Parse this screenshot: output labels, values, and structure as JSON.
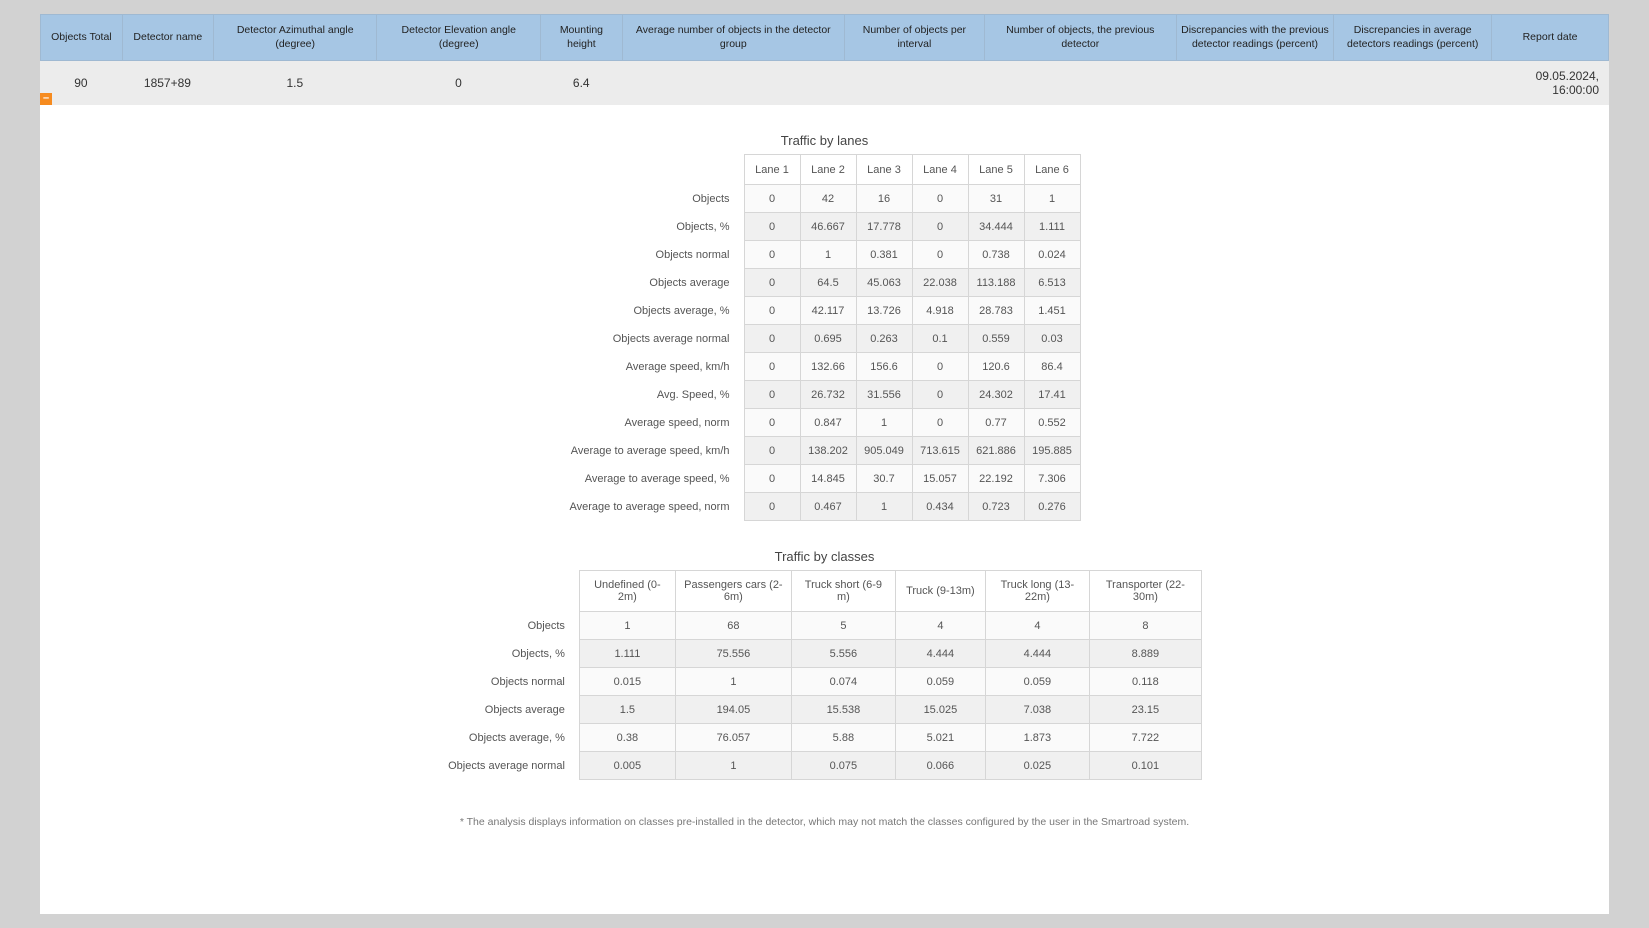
{
  "top": {
    "headers": [
      "Objects Total",
      "Detector name",
      "Detector Azimuthal angle (degree)",
      "Detector Elevation angle (degree)",
      "Mounting height",
      "Average number of objects in the detector group",
      "Number of objects per interval",
      "Number of objects, the previous detector",
      "Discrepancies with the previous detector readings (percent)",
      "Discrepancies in average detectors readings (percent)",
      "Report date"
    ],
    "row": {
      "objects_total": "90",
      "detector_name": "1857+89",
      "azimuth": "1.5",
      "elevation": "0",
      "mount_height": "6.4",
      "avg_group": "",
      "per_interval": "",
      "prev_detector": "",
      "discrep_prev": "",
      "discrep_avg": "",
      "report_date": "09.05.2024, 16:00:00"
    },
    "collapse_glyph": "–"
  },
  "lanes": {
    "title": "Traffic by lanes",
    "columns": [
      "Lane 1",
      "Lane 2",
      "Lane 3",
      "Lane 4",
      "Lane 5",
      "Lane 6"
    ],
    "rows": [
      {
        "label": "Objects",
        "v": [
          "0",
          "42",
          "16",
          "0",
          "31",
          "1"
        ]
      },
      {
        "label": "Objects, %",
        "v": [
          "0",
          "46.667",
          "17.778",
          "0",
          "34.444",
          "1.111"
        ]
      },
      {
        "label": "Objects normal",
        "v": [
          "0",
          "1",
          "0.381",
          "0",
          "0.738",
          "0.024"
        ]
      },
      {
        "label": "Objects average",
        "v": [
          "0",
          "64.5",
          "45.063",
          "22.038",
          "113.188",
          "6.513"
        ]
      },
      {
        "label": "Objects average, %",
        "v": [
          "0",
          "42.117",
          "13.726",
          "4.918",
          "28.783",
          "1.451"
        ]
      },
      {
        "label": "Objects average normal",
        "v": [
          "0",
          "0.695",
          "0.263",
          "0.1",
          "0.559",
          "0.03"
        ]
      },
      {
        "label": "Average speed, km/h",
        "v": [
          "0",
          "132.66",
          "156.6",
          "0",
          "120.6",
          "86.4"
        ]
      },
      {
        "label": "Avg. Speed, %",
        "v": [
          "0",
          "26.732",
          "31.556",
          "0",
          "24.302",
          "17.41"
        ]
      },
      {
        "label": "Average speed, norm",
        "v": [
          "0",
          "0.847",
          "1",
          "0",
          "0.77",
          "0.552"
        ]
      },
      {
        "label": "Average to average speed, km/h",
        "v": [
          "0",
          "138.202",
          "905.049",
          "713.615",
          "621.886",
          "195.885"
        ]
      },
      {
        "label": "Average to average speed, %",
        "v": [
          "0",
          "14.845",
          "30.7",
          "15.057",
          "22.192",
          "7.306"
        ]
      },
      {
        "label": "Average to average speed, norm",
        "v": [
          "0",
          "0.467",
          "1",
          "0.434",
          "0.723",
          "0.276"
        ]
      }
    ]
  },
  "classes": {
    "title": "Traffic by classes",
    "columns": [
      "Undefined (0-2m)",
      "Passengers cars (2-6m)",
      "Truck short (6-9 m)",
      "Truck (9-13m)",
      "Truck long (13-22m)",
      "Transporter (22-30m)"
    ],
    "rows": [
      {
        "label": "Objects",
        "v": [
          "1",
          "68",
          "5",
          "4",
          "4",
          "8"
        ]
      },
      {
        "label": "Objects, %",
        "v": [
          "1.111",
          "75.556",
          "5.556",
          "4.444",
          "4.444",
          "8.889"
        ]
      },
      {
        "label": "Objects normal",
        "v": [
          "0.015",
          "1",
          "0.074",
          "0.059",
          "0.059",
          "0.118"
        ]
      },
      {
        "label": "Objects average",
        "v": [
          "1.5",
          "194.05",
          "15.538",
          "15.025",
          "7.038",
          "23.15"
        ]
      },
      {
        "label": "Objects average, %",
        "v": [
          "0.38",
          "76.057",
          "5.88",
          "5.021",
          "1.873",
          "7.722"
        ]
      },
      {
        "label": "Objects average normal",
        "v": [
          "0.005",
          "1",
          "0.075",
          "0.066",
          "0.025",
          "0.101"
        ]
      }
    ]
  },
  "footnote": "* The analysis displays information on classes pre-installed in the detector, which may not match the classes configured by the user in the Smartroad system.",
  "chart_data": [
    {
      "type": "table",
      "title": "Traffic by lanes",
      "categories": [
        "Lane 1",
        "Lane 2",
        "Lane 3",
        "Lane 4",
        "Lane 5",
        "Lane 6"
      ],
      "series": [
        {
          "name": "Objects",
          "values": [
            0,
            42,
            16,
            0,
            31,
            1
          ]
        },
        {
          "name": "Objects, %",
          "values": [
            0,
            46.667,
            17.778,
            0,
            34.444,
            1.111
          ]
        },
        {
          "name": "Objects normal",
          "values": [
            0,
            1,
            0.381,
            0,
            0.738,
            0.024
          ]
        },
        {
          "name": "Objects average",
          "values": [
            0,
            64.5,
            45.063,
            22.038,
            113.188,
            6.513
          ]
        },
        {
          "name": "Objects average, %",
          "values": [
            0,
            42.117,
            13.726,
            4.918,
            28.783,
            1.451
          ]
        },
        {
          "name": "Objects average normal",
          "values": [
            0,
            0.695,
            0.263,
            0.1,
            0.559,
            0.03
          ]
        },
        {
          "name": "Average speed, km/h",
          "values": [
            0,
            132.66,
            156.6,
            0,
            120.6,
            86.4
          ]
        },
        {
          "name": "Avg. Speed, %",
          "values": [
            0,
            26.732,
            31.556,
            0,
            24.302,
            17.41
          ]
        },
        {
          "name": "Average speed, norm",
          "values": [
            0,
            0.847,
            1,
            0,
            0.77,
            0.552
          ]
        },
        {
          "name": "Average to average speed, km/h",
          "values": [
            0,
            138.202,
            905.049,
            713.615,
            621.886,
            195.885
          ]
        },
        {
          "name": "Average to average speed, %",
          "values": [
            0,
            14.845,
            30.7,
            15.057,
            22.192,
            7.306
          ]
        },
        {
          "name": "Average to average speed, norm",
          "values": [
            0,
            0.467,
            1,
            0.434,
            0.723,
            0.276
          ]
        }
      ]
    },
    {
      "type": "table",
      "title": "Traffic by classes",
      "categories": [
        "Undefined (0-2m)",
        "Passengers cars (2-6m)",
        "Truck short (6-9 m)",
        "Truck (9-13m)",
        "Truck long (13-22m)",
        "Transporter (22-30m)"
      ],
      "series": [
        {
          "name": "Objects",
          "values": [
            1,
            68,
            5,
            4,
            4,
            8
          ]
        },
        {
          "name": "Objects, %",
          "values": [
            1.111,
            75.556,
            5.556,
            4.444,
            4.444,
            8.889
          ]
        },
        {
          "name": "Objects normal",
          "values": [
            0.015,
            1,
            0.074,
            0.059,
            0.059,
            0.118
          ]
        },
        {
          "name": "Objects average",
          "values": [
            1.5,
            194.05,
            15.538,
            15.025,
            7.038,
            23.15
          ]
        },
        {
          "name": "Objects average, %",
          "values": [
            0.38,
            76.057,
            5.88,
            5.021,
            1.873,
            7.722
          ]
        },
        {
          "name": "Objects average normal",
          "values": [
            0.005,
            1,
            0.075,
            0.066,
            0.025,
            0.101
          ]
        }
      ]
    }
  ]
}
